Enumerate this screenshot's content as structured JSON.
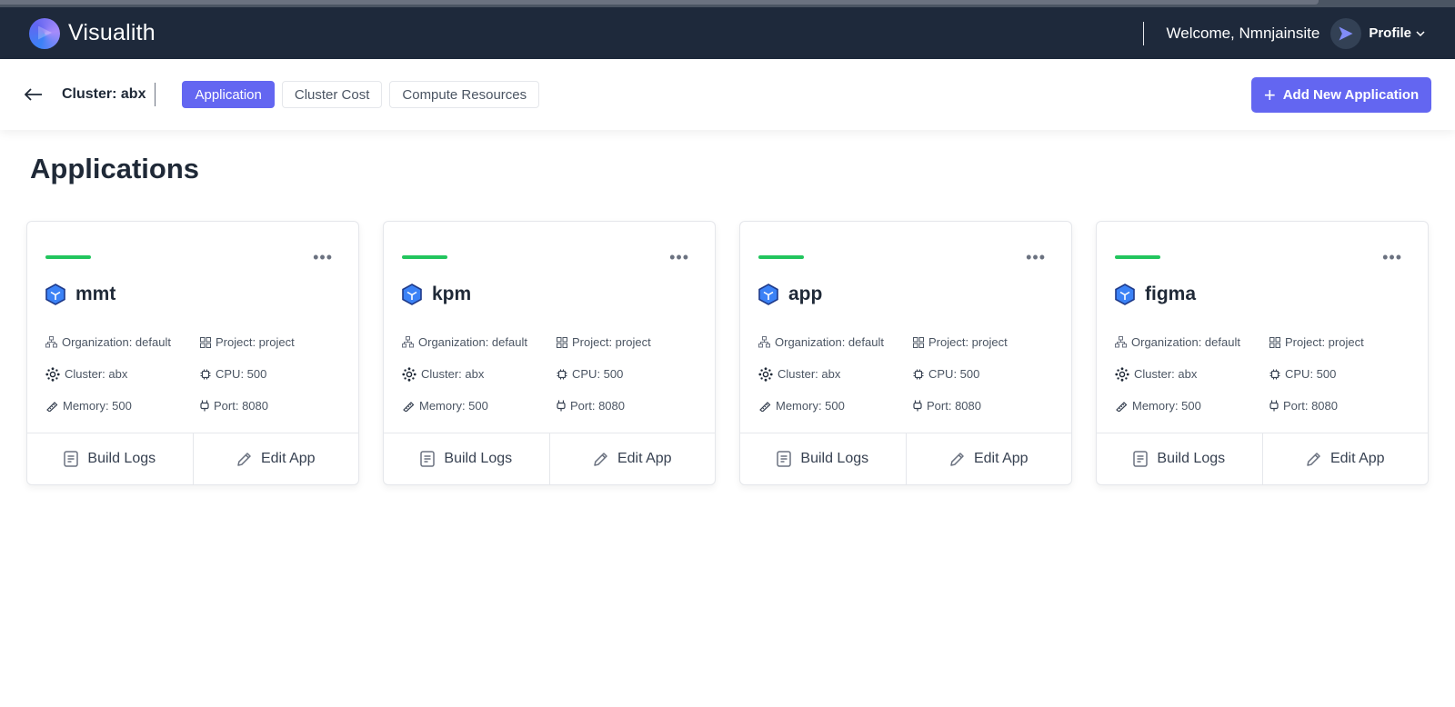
{
  "app": {
    "brand": "Visualith"
  },
  "navbar": {
    "welcome": "Welcome, Nmnjainsite",
    "profile_label": "Profile"
  },
  "subheader": {
    "cluster_label": "Cluster: abx",
    "tabs": [
      {
        "label": "Application",
        "active": true
      },
      {
        "label": "Cluster Cost",
        "active": false
      },
      {
        "label": "Compute Resources",
        "active": false
      }
    ],
    "add_button_label": "Add New Application"
  },
  "page": {
    "title": "Applications"
  },
  "cards": [
    {
      "name": "mmt",
      "organization": "Organization: default",
      "project": "Project: project",
      "cluster": "Cluster: abx",
      "cpu": "CPU: 500",
      "memory": "Memory: 500",
      "port": "Port: 8080",
      "build_logs": "Build Logs",
      "edit_app": "Edit App"
    },
    {
      "name": "kpm",
      "organization": "Organization: default",
      "project": "Project: project",
      "cluster": "Cluster: abx",
      "cpu": "CPU: 500",
      "memory": "Memory: 500",
      "port": "Port: 8080",
      "build_logs": "Build Logs",
      "edit_app": "Edit App"
    },
    {
      "name": "app",
      "organization": "Organization: default",
      "project": "Project: project",
      "cluster": "Cluster: abx",
      "cpu": "CPU: 500",
      "memory": "Memory: 500",
      "port": "Port: 8080",
      "build_logs": "Build Logs",
      "edit_app": "Edit App"
    },
    {
      "name": "figma",
      "organization": "Organization: default",
      "project": "Project: project",
      "cluster": "Cluster: abx",
      "cpu": "CPU: 500",
      "memory": "Memory: 500",
      "port": "Port: 8080",
      "build_logs": "Build Logs",
      "edit_app": "Edit App"
    }
  ],
  "colors": {
    "navbar_bg": "#1e293b",
    "accent": "#6366f1",
    "status_green": "#22c55e",
    "app_icon": "#3b82f6"
  },
  "icons": {
    "back": "arrow-left-icon",
    "app": "cube-icon",
    "organization": "org-tree-icon",
    "project": "grid-icon",
    "cluster": "cluster-icon",
    "cpu": "cpu-icon",
    "memory": "memory-icon",
    "port": "port-icon",
    "build_logs": "document-icon",
    "edit_app": "pencil-icon",
    "menu": "more-horizontal-icon",
    "profile": "send-icon"
  }
}
